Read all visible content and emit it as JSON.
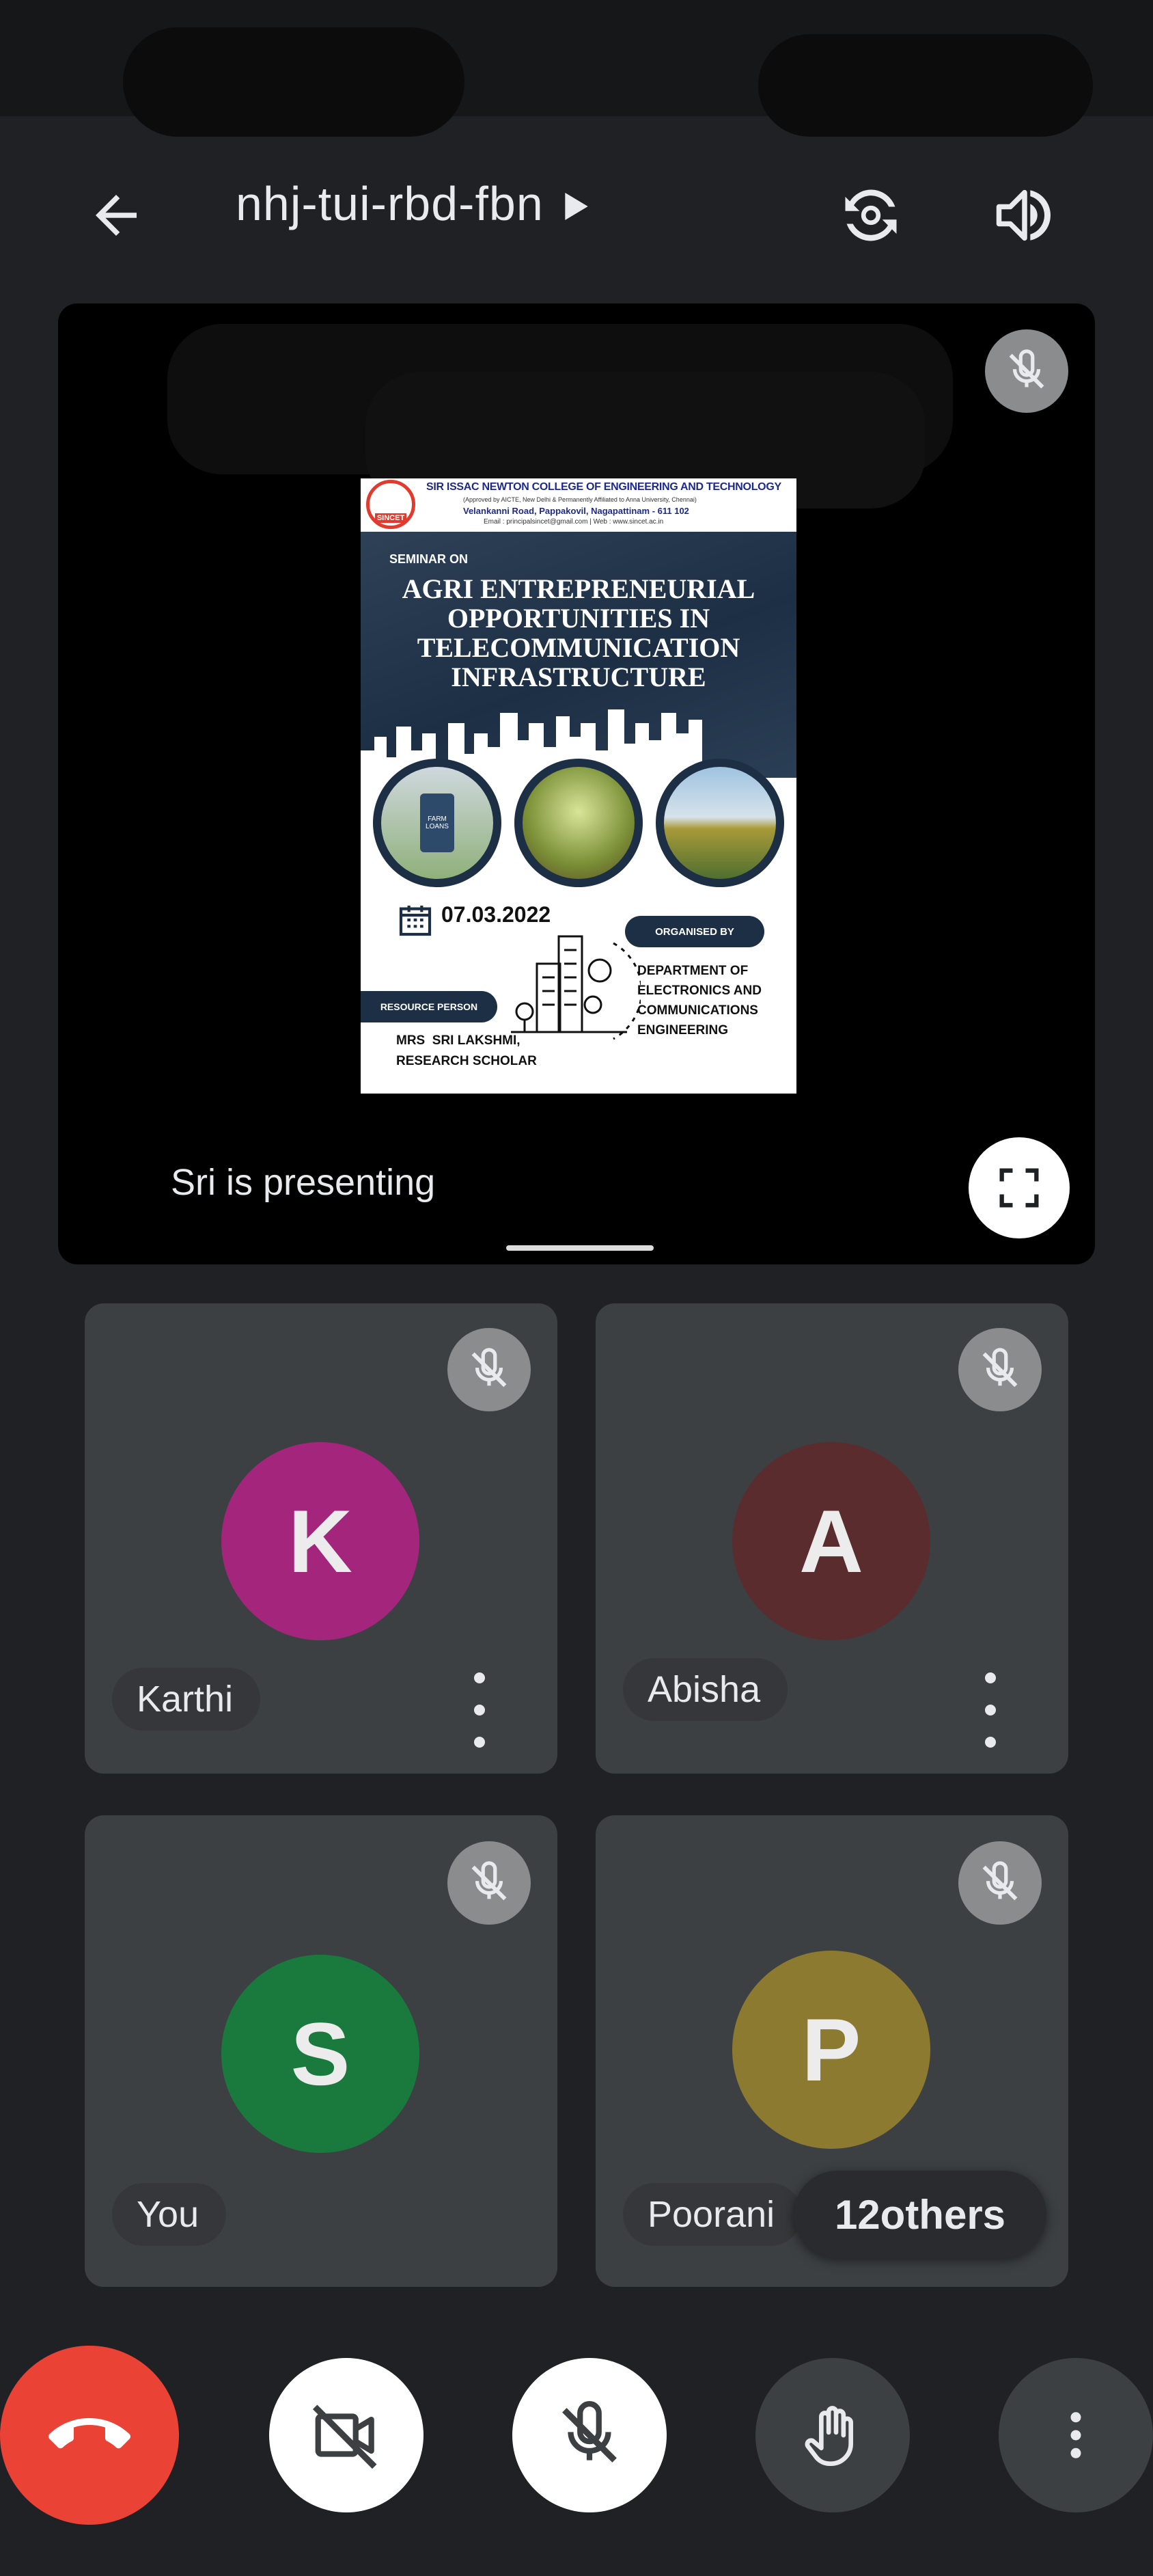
{
  "header": {
    "meeting_code": "nhj-tui-rbd-fbn"
  },
  "presentation": {
    "presenter_label": "Sri is presenting",
    "poster": {
      "college_name": "SIR ISSAC NEWTON COLLEGE OF ENGINEERING AND TECHNOLOGY",
      "approval": "(Approved by AICTE, New Delhi & Permanently Affiliated to Anna University, Chennai)",
      "address": "Velankanni Road, Pappakovil, Nagapattinam - 611 102",
      "contact": "Email : principalsincet@gmail.com | Web : www.sincet.ac.in",
      "logo_text": "SINCET",
      "seminar_label": "SEMINAR ON",
      "title_lines": [
        "AGRI ENTREPRENEURIAL",
        "OPPORTUNITIES IN",
        "TELECOMMUNICATION",
        "INFRASTRUCTURE"
      ],
      "phone_text": "FARM LOANS",
      "date": "07.03.2022",
      "organised_label": "ORGANISED BY",
      "department_lines": [
        "DEPARTMENT OF",
        "ELECTRONICS AND",
        "COMMUNICATIONS",
        "ENGINEERING"
      ],
      "resource_label": "RESOURCE PERSON",
      "resource_lines": [
        "MRS  SRI LAKSHMI,",
        "RESEARCH SCHOLAR"
      ]
    }
  },
  "participants": [
    {
      "initial": "K",
      "name": "Karthi",
      "color": "#a4267c"
    },
    {
      "initial": "A",
      "name": "Abisha",
      "color": "#5a2c2e"
    },
    {
      "initial": "S",
      "name": "You",
      "color": "#1a7a3e"
    },
    {
      "initial": "P",
      "name": "Poorani",
      "color": "#8c7a30"
    }
  ],
  "others_label": "12others",
  "icons": [
    "back-arrow-icon",
    "switch-camera-icon",
    "speaker-icon",
    "mic-off-icon",
    "fullscreen-icon",
    "more-vert-icon",
    "end-call-icon",
    "camera-off-icon",
    "raise-hand-icon"
  ],
  "colors": {
    "end_call": "#ea4335",
    "background": "#202124",
    "tile": "#3c4043"
  }
}
